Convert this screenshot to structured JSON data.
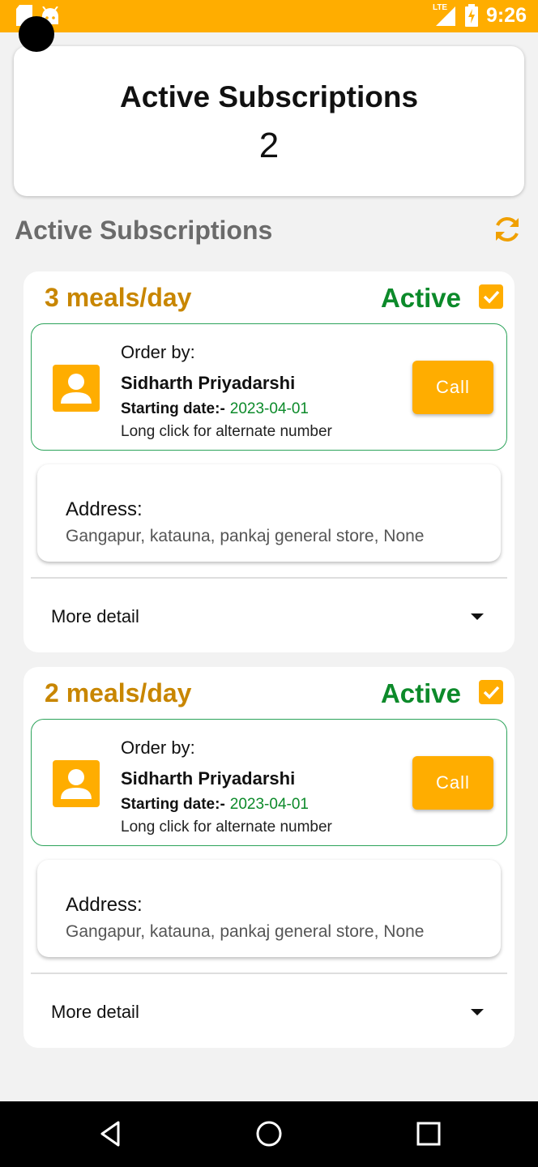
{
  "status_bar": {
    "network": "LTE",
    "time": "9:26"
  },
  "summary": {
    "title": "Active Subscriptions",
    "count": "2"
  },
  "section": {
    "title": "Active Subscriptions"
  },
  "subscriptions": [
    {
      "meals": "3 meals/day",
      "status": "Active",
      "order_by_label": "Order by:",
      "customer_name": "Sidharth Priyadarshi",
      "starting_date_label": "Starting date:-",
      "starting_date": "2023-04-01",
      "alternate_hint": "Long click for alternate number",
      "call_label": "Call",
      "address_label": "Address:",
      "address": "Gangapur, katauna, pankaj general store, None",
      "more_detail": "More detail"
    },
    {
      "meals": "2 meals/day",
      "status": "Active",
      "order_by_label": "Order by:",
      "customer_name": "Sidharth Priyadarshi",
      "starting_date_label": "Starting date:-",
      "starting_date": "2023-04-01",
      "alternate_hint": "Long click for alternate number",
      "call_label": "Call",
      "address_label": "Address:",
      "address": "Gangapur, katauna, pankaj general store, None",
      "more_detail": "More detail"
    }
  ],
  "colors": {
    "accent": "#ffad00",
    "meals_text": "#c88600",
    "active_green": "#0c8a2a"
  },
  "icons": [
    "sd-card-icon",
    "android-icon",
    "lte-signal-icon",
    "battery-charging-icon",
    "refresh-icon",
    "checkbox-checked-icon",
    "person-icon",
    "dropdown-arrow-icon",
    "back-icon",
    "home-icon",
    "recents-icon"
  ]
}
